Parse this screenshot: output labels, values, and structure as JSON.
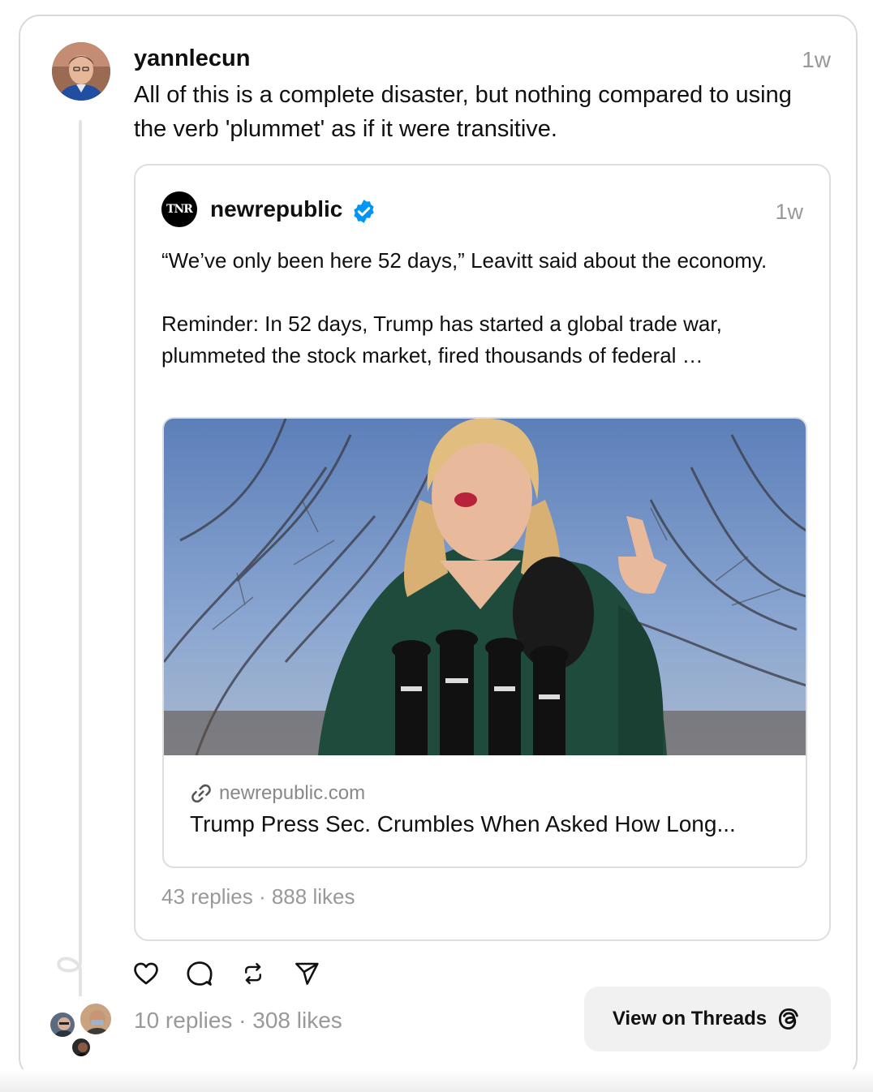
{
  "post": {
    "username": "yannlecun",
    "time": "1w",
    "text": "All of this is a complete disaster, but nothing compared to using the verb 'plummet' as if it were transitive.",
    "stats": "10 replies · 308 likes"
  },
  "quoted": {
    "avatar_text": "TNR",
    "username": "newrepublic",
    "verified": true,
    "time": "1w",
    "paragraphs": [
      "“We’ve only been here 52 days,” Leavitt said about the economy.",
      "Reminder: In 52 days, Trump has started a global trade war, plummeted the stock market, fired thousands of federal …"
    ],
    "link": {
      "domain": "newrepublic.com",
      "title": "Trump Press Sec. Crumbles When Asked How Long..."
    },
    "stats": "43 replies · 888 likes"
  },
  "actions": {
    "icons": [
      "heart-icon",
      "comment-icon",
      "repost-icon",
      "share-icon"
    ]
  },
  "view_button": {
    "label": "View on Threads"
  },
  "colors": {
    "secondary_text": "#999999",
    "verified_blue": "#0095f6",
    "border": "#d9d9d9"
  }
}
